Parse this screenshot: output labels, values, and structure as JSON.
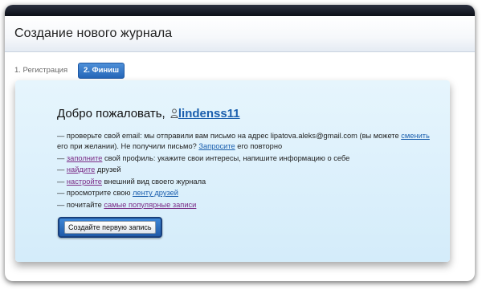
{
  "header": {
    "title": "Создание нового журнала"
  },
  "steps": [
    {
      "label": "1. Регистрация"
    },
    {
      "label": "2. Финиш"
    }
  ],
  "welcome": {
    "greeting": "Добро пожаловать,",
    "username": "lindenss11"
  },
  "tasks": {
    "email": {
      "prefix": "— проверьте свой email: мы отправили вам письмо на адрес lipatova.aleks@gmail.com (вы можете ",
      "change_link": "сменить",
      "middle": " его при желании). Не получили письмо? ",
      "resend_link": "Запросите",
      "suffix": " его повторно"
    },
    "profile": {
      "prefix": "— ",
      "link": "заполните",
      "suffix": " свой профиль: укажите свои интересы, напишите информацию о себе"
    },
    "friends": {
      "prefix": "— ",
      "link": "найдите",
      "suffix": " друзей"
    },
    "style": {
      "prefix": "— ",
      "link": "настройте",
      "suffix": " внешний вид своего журнала"
    },
    "feed": {
      "prefix": "— просмотрите свою ",
      "link": "ленту друзей",
      "suffix": ""
    },
    "popular": {
      "prefix": "— почитайте ",
      "link": "самые популярные записи",
      "suffix": ""
    }
  },
  "button": {
    "create_post": "Создайте первую запись"
  }
}
